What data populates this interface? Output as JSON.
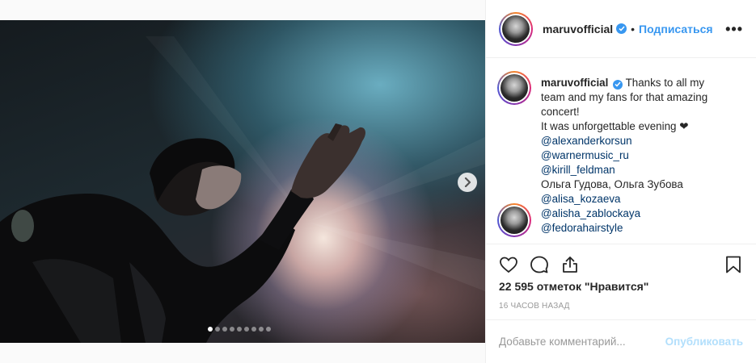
{
  "post": {
    "carousel": {
      "slide_count": 9,
      "active_index": 0
    }
  },
  "header": {
    "username": "maruvofficial",
    "follow_label": "Подписаться",
    "separator": "•",
    "more_label": "•••"
  },
  "caption": {
    "username": "maruvofficial",
    "lines": [
      "Thanks to all my",
      "team and my fans for that amazing",
      "concert!",
      "It was unforgettable evening ❤"
    ],
    "mentions": [
      "@alexanderkorsun",
      "@warnermusic_ru",
      "@kirill_feldman"
    ],
    "names_line": "Ольга Гудова, Ольга Зубова",
    "mentions2": [
      "@alisa_kozaeva",
      "@alisha_zablockaya",
      "@fedorahairstyle"
    ]
  },
  "actions": {
    "icons": [
      "heart-icon",
      "comment-icon",
      "share-icon",
      "bookmark-icon"
    ]
  },
  "likes_text": "22 595 отметок \"Нравится\"",
  "timestamp": "16 часов назад",
  "comment_box": {
    "placeholder": "Добавьте комментарий...",
    "publish_label": "Опубликовать"
  },
  "colors": {
    "accent": "#3897f0",
    "mention": "#003569",
    "publish_disabled": "#b2dffc",
    "muted": "#999999"
  }
}
